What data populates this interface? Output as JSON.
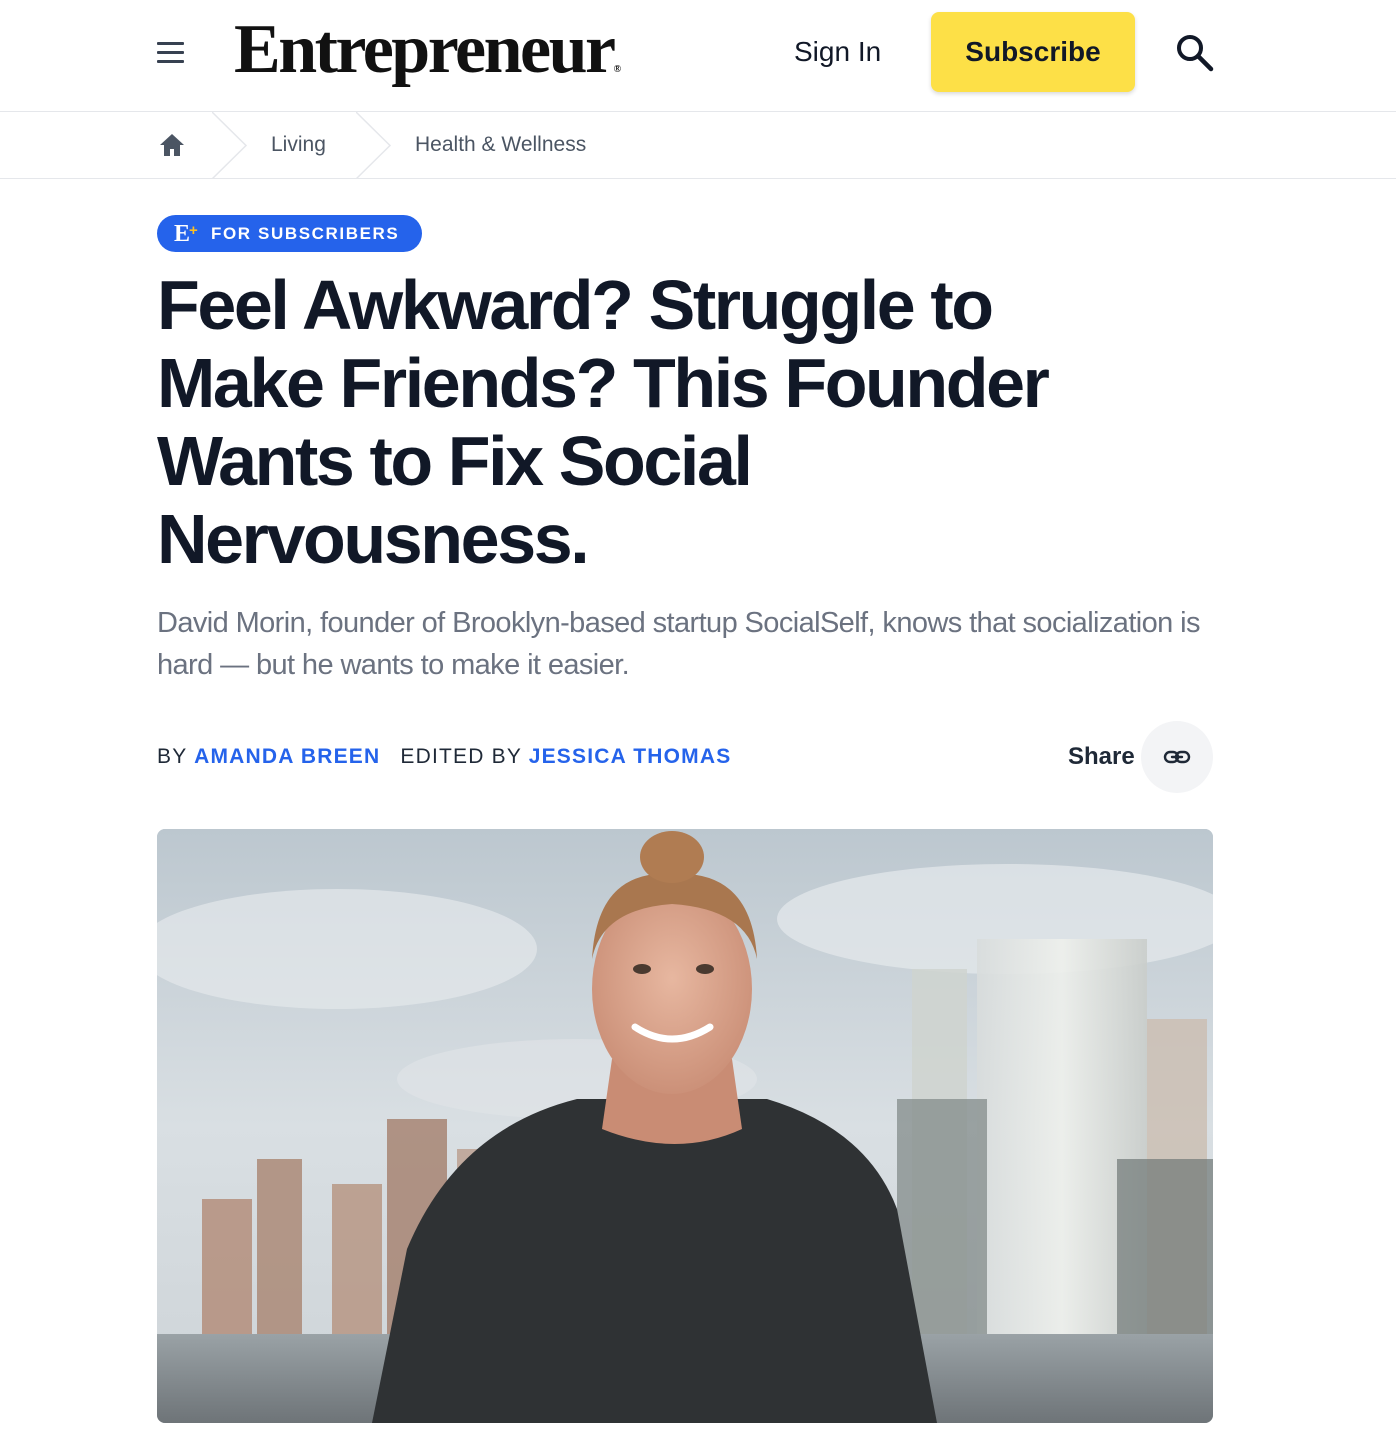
{
  "header": {
    "menu_icon": "hamburger-menu-icon",
    "logo": "Entrepreneur",
    "sign_in_label": "Sign In",
    "subscribe_label": "Subscribe",
    "search_icon": "search-icon",
    "subscribe_color": "#fde047"
  },
  "breadcrumb": {
    "home_icon": "home-icon",
    "items": [
      {
        "label": "Living"
      },
      {
        "label": "Health & Wellness"
      }
    ]
  },
  "article": {
    "badge": {
      "logo_text": "E",
      "logo_plus": "+",
      "label": "FOR SUBSCRIBERS",
      "color": "#2563eb"
    },
    "headline": "Feel Awkward? Struggle to Make Friends? This Founder Wants to Fix Social Nervousness.",
    "dek": "David Morin, founder of Brooklyn-based startup SocialSelf, knows that socialization is hard — but he wants to make it easier.",
    "byline": {
      "by_prefix": "BY",
      "author": "AMANDA BREEN",
      "edited_prefix": "EDITED BY",
      "editor": "JESSICA THOMAS",
      "accent_color": "#2563eb"
    },
    "share": {
      "label": "Share",
      "icon": "link-icon"
    },
    "hero_image": {
      "icon": "photo-founder-city-skyline"
    }
  }
}
